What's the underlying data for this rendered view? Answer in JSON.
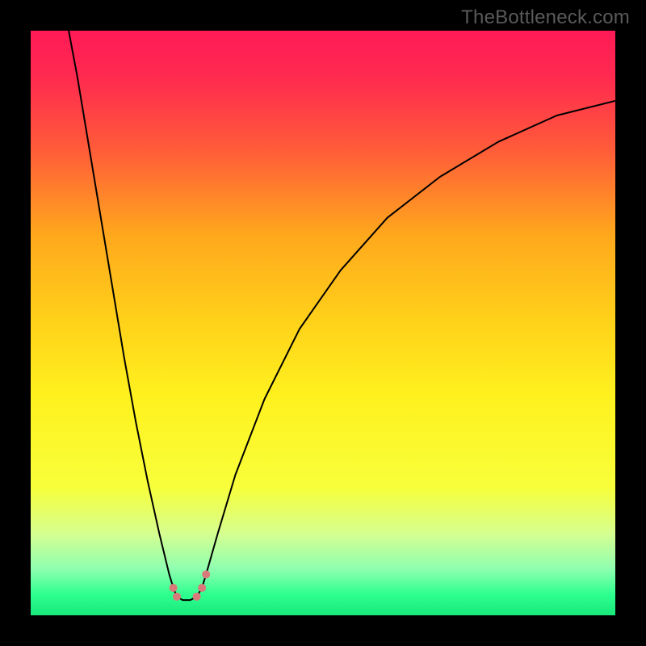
{
  "watermark": "TheBottleneck.com",
  "chart_data": {
    "type": "line",
    "title": "",
    "xlabel": "",
    "ylabel": "",
    "xlim": [
      0,
      100
    ],
    "ylim": [
      0,
      100
    ],
    "gradient_stops": [
      {
        "offset": 0.0,
        "color": "#ff1a56"
      },
      {
        "offset": 0.08,
        "color": "#ff2a4f"
      },
      {
        "offset": 0.2,
        "color": "#ff5a3a"
      },
      {
        "offset": 0.35,
        "color": "#ffa81c"
      },
      {
        "offset": 0.5,
        "color": "#ffd21a"
      },
      {
        "offset": 0.62,
        "color": "#fff01e"
      },
      {
        "offset": 0.78,
        "color": "#f8ff3a"
      },
      {
        "offset": 0.86,
        "color": "#d6ff90"
      },
      {
        "offset": 0.92,
        "color": "#8fffb0"
      },
      {
        "offset": 0.965,
        "color": "#2dff8f"
      },
      {
        "offset": 1.0,
        "color": "#19e87a"
      }
    ],
    "series": [
      {
        "name": "bottleneck-curve",
        "color": "#000000",
        "width": 2,
        "points": [
          {
            "x": 6.5,
            "y": 100.0
          },
          {
            "x": 8.0,
            "y": 92.0
          },
          {
            "x": 10.0,
            "y": 80.0
          },
          {
            "x": 12.0,
            "y": 68.0
          },
          {
            "x": 14.0,
            "y": 56.0
          },
          {
            "x": 16.0,
            "y": 44.0
          },
          {
            "x": 18.0,
            "y": 33.0
          },
          {
            "x": 20.0,
            "y": 23.0
          },
          {
            "x": 22.0,
            "y": 14.0
          },
          {
            "x": 23.7,
            "y": 7.0
          },
          {
            "x": 24.4,
            "y": 4.7
          },
          {
            "x": 25.0,
            "y": 3.2
          },
          {
            "x": 26.0,
            "y": 2.6
          },
          {
            "x": 27.3,
            "y": 2.6
          },
          {
            "x": 28.4,
            "y": 3.2
          },
          {
            "x": 29.3,
            "y": 4.7
          },
          {
            "x": 30.0,
            "y": 7.0
          },
          {
            "x": 32.0,
            "y": 14.0
          },
          {
            "x": 35.0,
            "y": 24.0
          },
          {
            "x": 40.0,
            "y": 37.0
          },
          {
            "x": 46.0,
            "y": 49.0
          },
          {
            "x": 53.0,
            "y": 59.0
          },
          {
            "x": 61.0,
            "y": 68.0
          },
          {
            "x": 70.0,
            "y": 75.0
          },
          {
            "x": 80.0,
            "y": 81.0
          },
          {
            "x": 90.0,
            "y": 85.5
          },
          {
            "x": 100.0,
            "y": 88.0
          }
        ]
      }
    ],
    "markers": [
      {
        "name": "marker-left-upper",
        "x": 24.4,
        "y": 4.7,
        "color": "#d97a7a",
        "r": 5
      },
      {
        "name": "marker-left-lower",
        "x": 25.0,
        "y": 3.2,
        "color": "#d97a7a",
        "r": 5
      },
      {
        "name": "marker-right-lower",
        "x": 28.4,
        "y": 3.2,
        "color": "#d97a7a",
        "r": 5
      },
      {
        "name": "marker-right-upper",
        "x": 29.3,
        "y": 4.7,
        "color": "#d97a7a",
        "r": 5
      },
      {
        "name": "marker-right-top",
        "x": 30.0,
        "y": 7.0,
        "color": "#d97a7a",
        "r": 5
      }
    ]
  }
}
